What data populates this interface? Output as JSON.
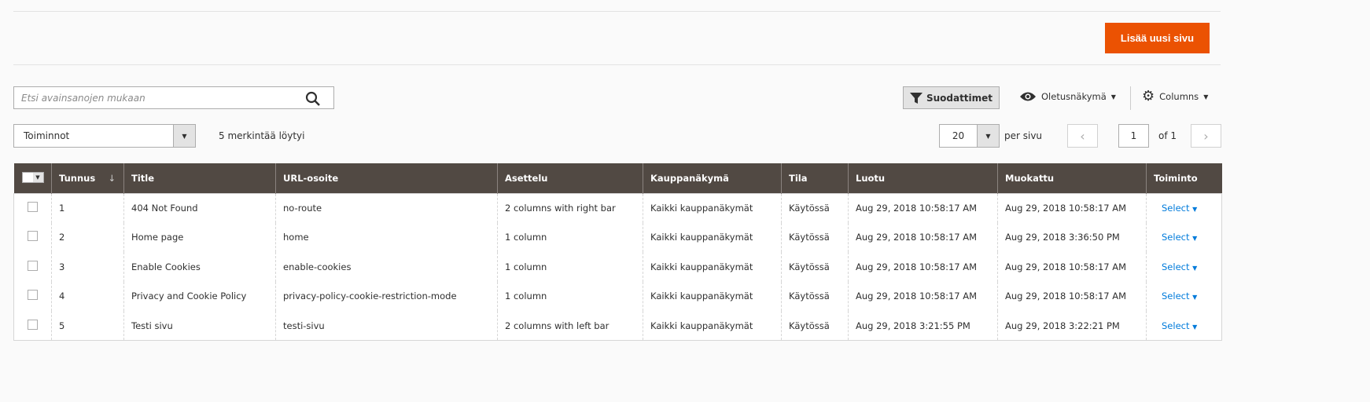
{
  "header": {
    "add_button": "Lisää uusi sivu"
  },
  "toolbar": {
    "search_placeholder": "Etsi avainsanojen mukaan",
    "filters": "Suodattimet",
    "view": "Oletusnäkymä",
    "columns": "Columns",
    "actions": "Toiminnot",
    "found": "5 merkintää löytyi",
    "per_page_value": "20",
    "per_page_label": "per sivu",
    "page": "1",
    "of_pages": "of 1"
  },
  "colors": {
    "accent": "#eb5202",
    "header_bg": "#514943",
    "link": "#007bdb"
  },
  "table": {
    "headers": [
      "Tunnus",
      "Title",
      "URL-osoite",
      "Asettelu",
      "Kauppanäkymä",
      "Tila",
      "Luotu",
      "Muokattu",
      "Toiminto"
    ],
    "rows": [
      [
        "1",
        "404 Not Found",
        "no-route",
        "2 columns with right bar",
        "Kaikki kauppanäkymät",
        "Käytössä",
        "Aug 29, 2018 10:58:17 AM",
        "Aug 29, 2018 10:58:17 AM",
        "Select"
      ],
      [
        "2",
        "Home page",
        "home",
        "1 column",
        "Kaikki kauppanäkymät",
        "Käytössä",
        "Aug 29, 2018 10:58:17 AM",
        "Aug 29, 2018 3:36:50 PM",
        "Select"
      ],
      [
        "3",
        "Enable Cookies",
        "enable-cookies",
        "1 column",
        "Kaikki kauppanäkymät",
        "Käytössä",
        "Aug 29, 2018 10:58:17 AM",
        "Aug 29, 2018 10:58:17 AM",
        "Select"
      ],
      [
        "4",
        "Privacy and Cookie Policy",
        "privacy-policy-cookie-restriction-mode",
        "1 column",
        "Kaikki kauppanäkymät",
        "Käytössä",
        "Aug 29, 2018 10:58:17 AM",
        "Aug 29, 2018 10:58:17 AM",
        "Select"
      ],
      [
        "5",
        "Testi sivu",
        "testi-sivu",
        "2 columns with left bar",
        "Kaikki kauppanäkymät",
        "Käytössä",
        "Aug 29, 2018 3:21:55 PM",
        "Aug 29, 2018 3:22:21 PM",
        "Select"
      ]
    ]
  }
}
